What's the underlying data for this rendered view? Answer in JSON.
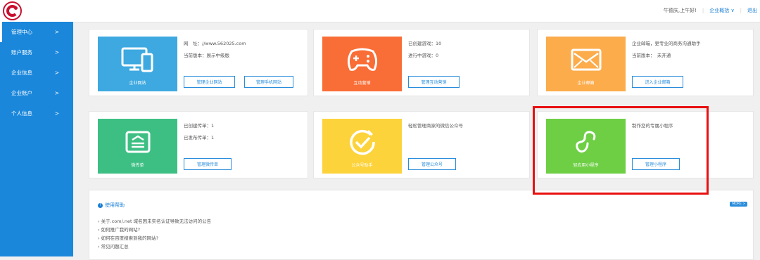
{
  "header": {
    "greeting": "牛德庆,上午好!",
    "overview_label": "企业概括",
    "overview_arrow": "∨",
    "logout_label": "退出"
  },
  "sidebar": {
    "items": [
      {
        "label": "管理中心",
        "arrow": ">"
      },
      {
        "label": "账户服务",
        "arrow": ">"
      },
      {
        "label": "企业信息",
        "arrow": ">"
      },
      {
        "label": "企业账户",
        "arrow": ">"
      },
      {
        "label": "个人信息",
        "arrow": ">"
      }
    ]
  },
  "cards": {
    "website": {
      "tile_label": "企业网站",
      "color": "#3ea9e0",
      "line1": "网　址：//www.562025.com",
      "line2": "当前版本：展示中级版",
      "btn1": "管理企业网站",
      "btn2": "管理手机网站"
    },
    "games": {
      "tile_label": "互动营销",
      "color": "#f96d36",
      "line1": "已创建游戏：10",
      "line2": "进行中游戏：0",
      "btn1": "管理互动营销"
    },
    "mail": {
      "tile_label": "企业邮箱",
      "color": "#fcac4b",
      "line1": "企业邮箱，更专业的商务沟通助手",
      "line2": "当前版本：　未开通",
      "btn1": "进入企业邮箱"
    },
    "flyer": {
      "tile_label": "微传单",
      "color": "#3dbf84",
      "line1": "已创建传单：1",
      "line2": "已发布传单：1",
      "btn1": "管理微传单"
    },
    "wechat": {
      "tile_label": "公众号助手",
      "color": "#fdd33c",
      "line1": "轻松管理商家的微信公众号",
      "btn1": "管理公众号"
    },
    "miniapp": {
      "tile_label": "轻应用小程序",
      "color": "#6ecf45",
      "line1": "制作您的专属小程序",
      "btn1": "管理小程序"
    }
  },
  "help": {
    "title": "使用帮助",
    "more": "MORE >",
    "items": [
      "› 关于.com/.net 域名因未实名认证导致无法访问的公告",
      "› 如何推广我的网站?",
      "› 如何在百度搜索到我的网站?",
      "› 常见问题汇总"
    ]
  }
}
